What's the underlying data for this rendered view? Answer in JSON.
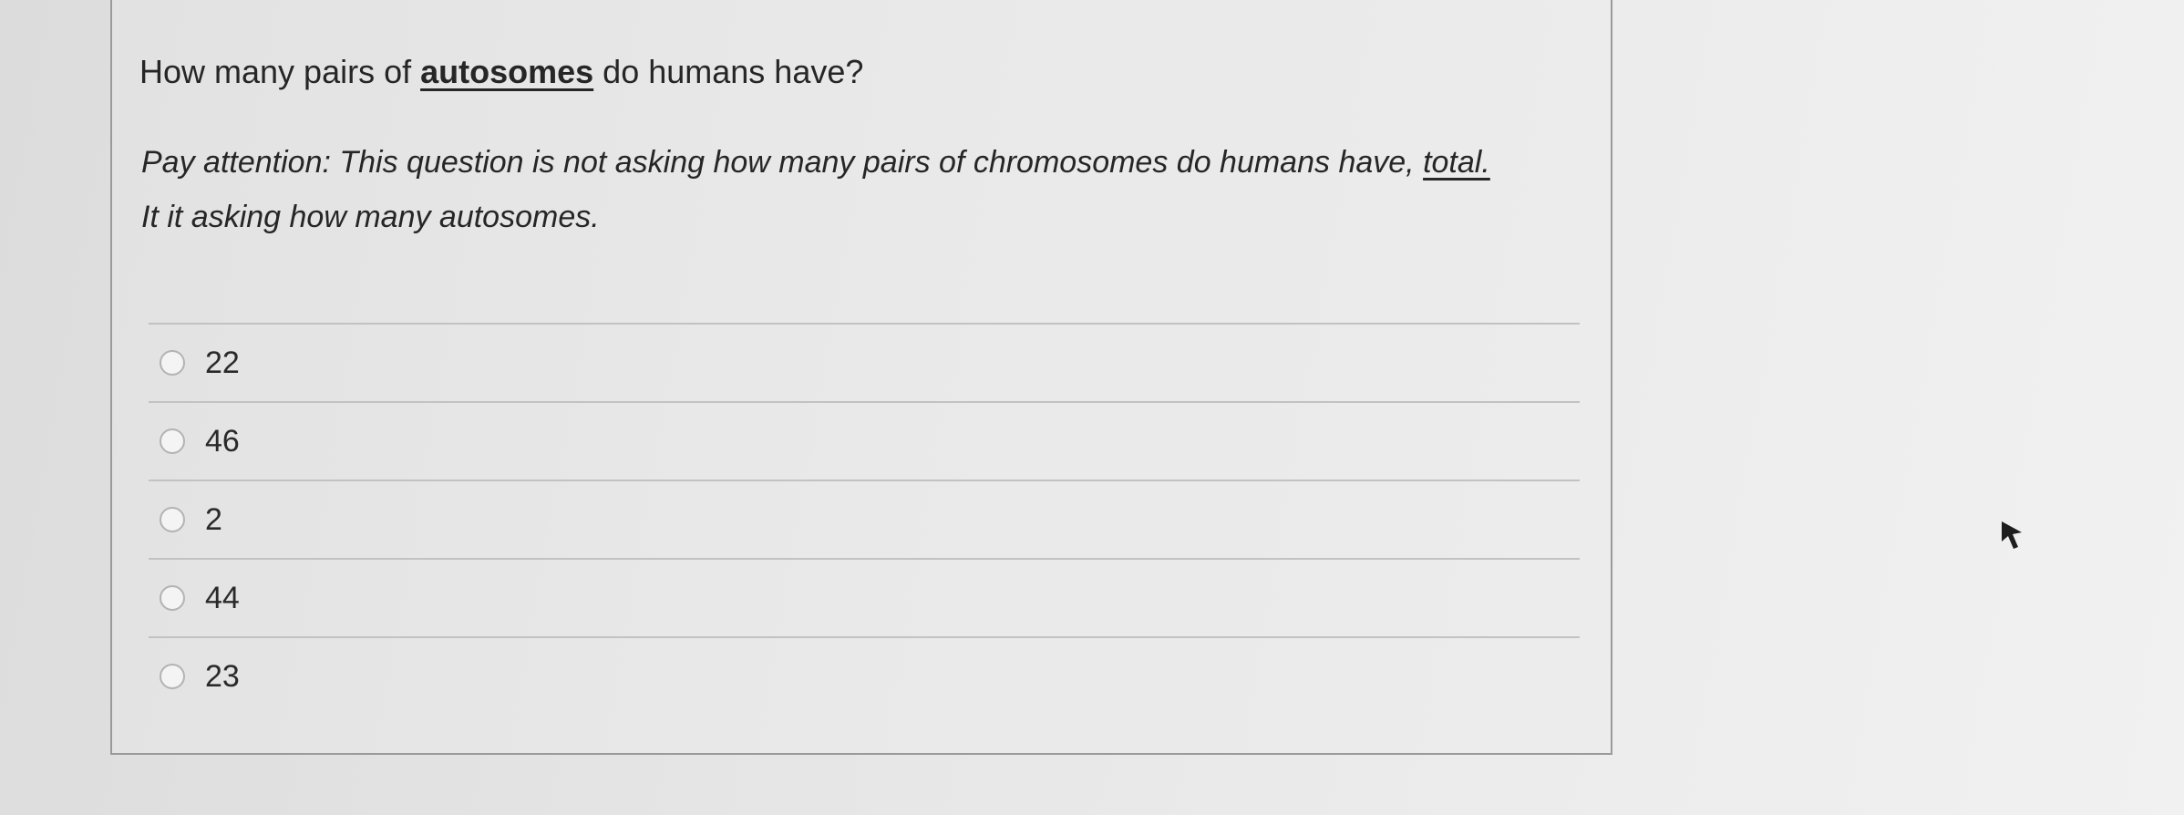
{
  "question": {
    "prefix": "How many pairs of ",
    "emphasis": "autosomes",
    "suffix": " do humans have?"
  },
  "attention": {
    "line1_prefix": "Pay attention: This question is not asking how many pairs of chromosomes do humans have, ",
    "line1_total": "total.",
    "line2": "It it asking how many autosomes."
  },
  "answers": [
    {
      "label": "22"
    },
    {
      "label": "46"
    },
    {
      "label": "2"
    },
    {
      "label": "44"
    },
    {
      "label": "23"
    }
  ],
  "icons": {
    "radio": "radio-unselected-icon",
    "cursor": "mouse-pointer-icon"
  },
  "colors": {
    "background": "#e6e6e6",
    "card_border": "#9a9a9a",
    "text": "#262626",
    "divider": "#c2c2c2"
  }
}
